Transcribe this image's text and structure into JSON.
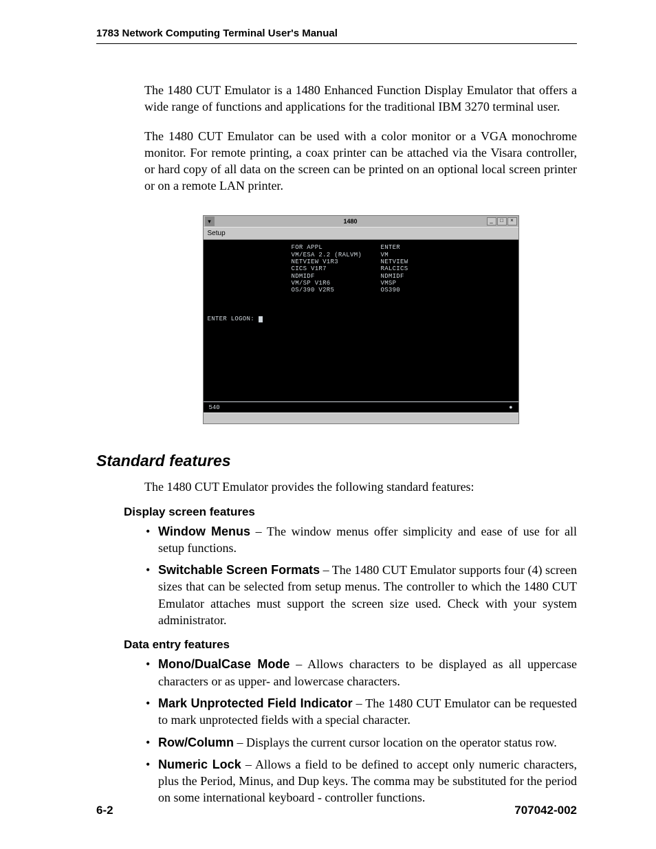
{
  "header": "1783 Network Computing Terminal User's Manual",
  "paragraphs": {
    "p1": "The 1480 CUT Emulator is a 1480 Enhanced Function Display Emulator that offers a wide range of functions and applications for the traditional IBM 3270 terminal user.",
    "p2": "The 1480 CUT Emulator can be used with a color monitor or a VGA monochrome monitor. For remote printing, a coax printer can be attached via the Visara controller, or hard copy of all data on the screen can be printed on an optional local screen printer or on a remote LAN printer."
  },
  "figure": {
    "title": "1480",
    "menubar": "Setup",
    "col2": [
      "FOR APPL",
      "VM/ESA 2.2 (RALVM)",
      "NETVIEW V1R3",
      "CICS V1R7",
      "NDMIDF",
      "VM/SP V1R6",
      "OS/390 V2R5"
    ],
    "col3": [
      "ENTER",
      "VM",
      "NETVIEW",
      "RALCICS",
      "NDMIDF",
      "  VMSP",
      "OS390"
    ],
    "login": "ENTER LOGON:",
    "status_left": "540",
    "status_right": "●"
  },
  "section_heading": "Standard features",
  "section_intro": "The 1480 CUT Emulator provides the following standard features:",
  "subsections": {
    "display": {
      "heading": "Display screen features",
      "items": [
        {
          "name": "Window Menus",
          "desc": " – The window menus offer simplicity and ease of use for all setup functions."
        },
        {
          "name": "Switchable Screen Formats",
          "desc": " – The 1480 CUT Emulator supports four (4) screen sizes that can be selected from setup menus. The controller to which the 1480 CUT Emulator attaches must support the screen size used. Check with your system administrator."
        }
      ]
    },
    "data_entry": {
      "heading": "Data entry features",
      "items": [
        {
          "name": "Mono/DualCase Mode",
          "desc": " – Allows characters to be displayed as all uppercase characters or as upper- and lowercase characters."
        },
        {
          "name": "Mark Unprotected Field Indicator",
          "desc": " – The 1480 CUT Emulator can be requested to mark unprotected fields with a special character."
        },
        {
          "name": "Row/Column",
          "desc": " – Displays the current cursor location on the operator status row."
        },
        {
          "name": "Numeric Lock",
          "desc": " – Allows a field to be defined to accept only numeric characters, plus the Period, Minus, and Dup keys. The comma may be substituted for the period on some international keyboard - controller functions."
        }
      ]
    }
  },
  "footer": {
    "page": "6-2",
    "docnum": "707042-002"
  }
}
